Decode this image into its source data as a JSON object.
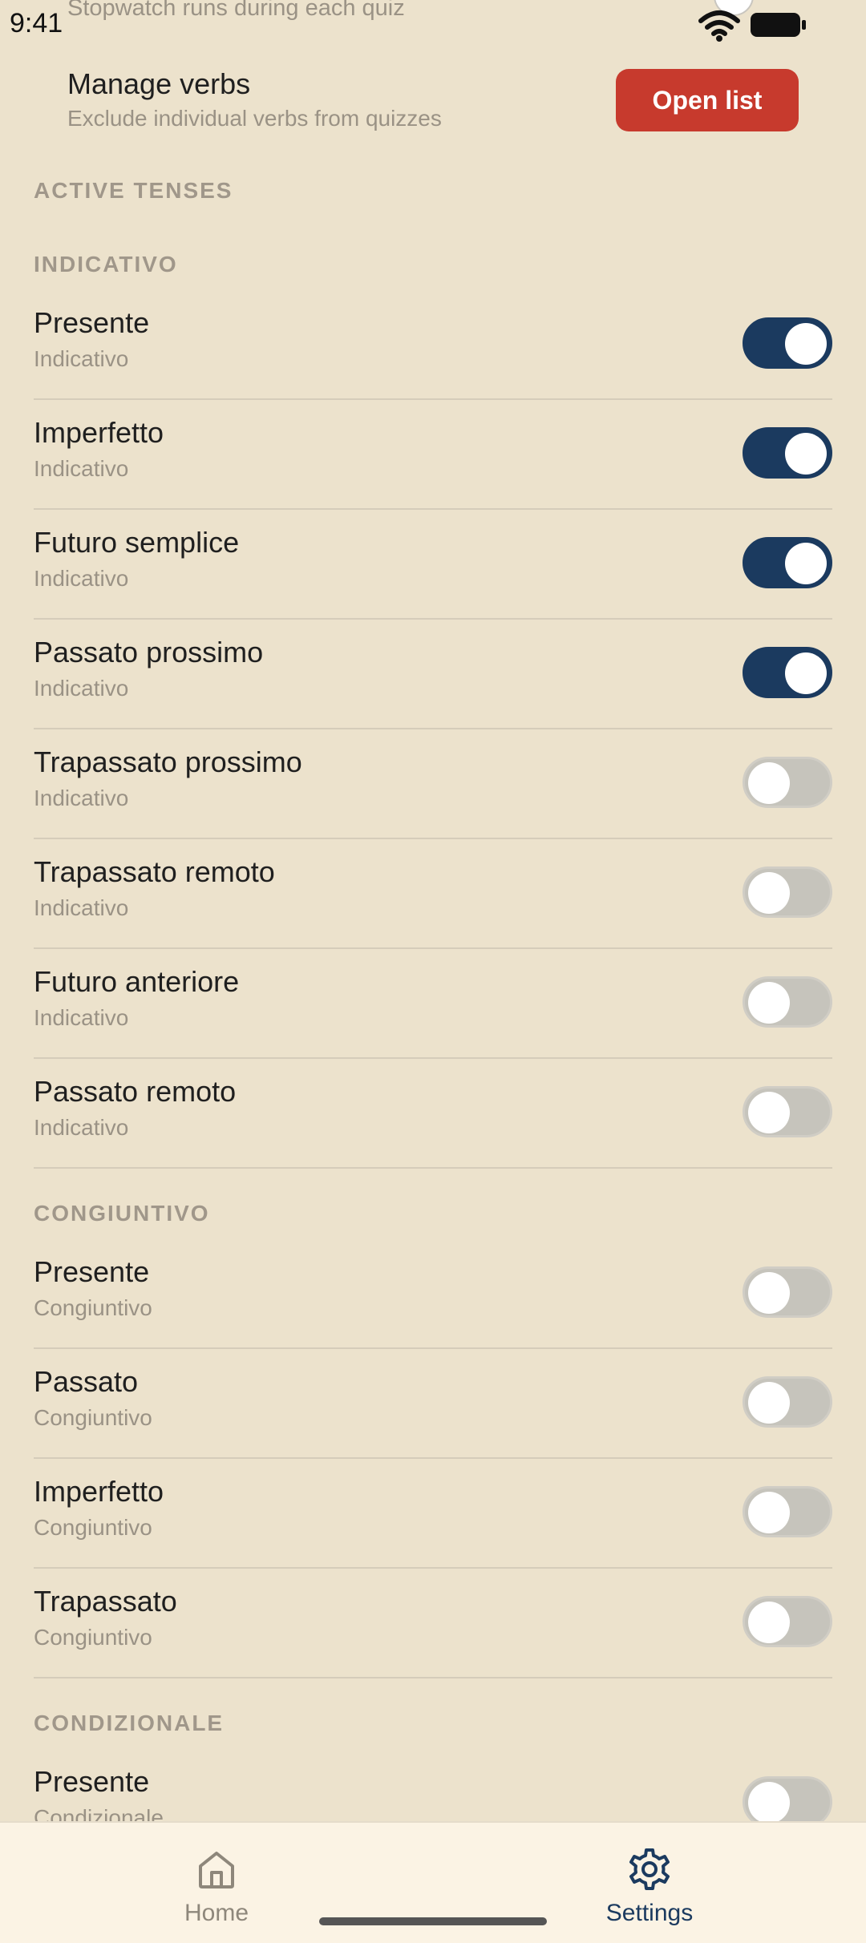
{
  "status": {
    "time": "9:41"
  },
  "peek": {
    "text": "Stopwatch runs during each quiz"
  },
  "manage": {
    "title": "Manage verbs",
    "subtitle": "Exclude individual verbs from quizzes",
    "button": "Open list"
  },
  "section_title": "ACTIVE TENSES",
  "groups": {
    "indicativo": {
      "header": "INDICATIVO",
      "rows": [
        {
          "title": "Presente",
          "sub": "Indicativo",
          "on": true
        },
        {
          "title": "Imperfetto",
          "sub": "Indicativo",
          "on": true
        },
        {
          "title": "Futuro semplice",
          "sub": "Indicativo",
          "on": true
        },
        {
          "title": "Passato prossimo",
          "sub": "Indicativo",
          "on": true
        },
        {
          "title": "Trapassato prossimo",
          "sub": "Indicativo",
          "on": false
        },
        {
          "title": "Trapassato remoto",
          "sub": "Indicativo",
          "on": false
        },
        {
          "title": "Futuro anteriore",
          "sub": "Indicativo",
          "on": false
        },
        {
          "title": "Passato remoto",
          "sub": "Indicativo",
          "on": false
        }
      ]
    },
    "congiuntivo": {
      "header": "CONGIUNTIVO",
      "rows": [
        {
          "title": "Presente",
          "sub": "Congiuntivo",
          "on": false
        },
        {
          "title": "Passato",
          "sub": "Congiuntivo",
          "on": false
        },
        {
          "title": "Imperfetto",
          "sub": "Congiuntivo",
          "on": false
        },
        {
          "title": "Trapassato",
          "sub": "Congiuntivo",
          "on": false
        }
      ]
    },
    "condizionale": {
      "header": "CONDIZIONALE",
      "rows": [
        {
          "title": "Presente",
          "sub": "Condizionale",
          "on": false
        }
      ]
    }
  },
  "nav": {
    "home": {
      "label": "Home",
      "icon": "home-icon"
    },
    "settings": {
      "label": "Settings",
      "icon": "gear-icon"
    }
  }
}
